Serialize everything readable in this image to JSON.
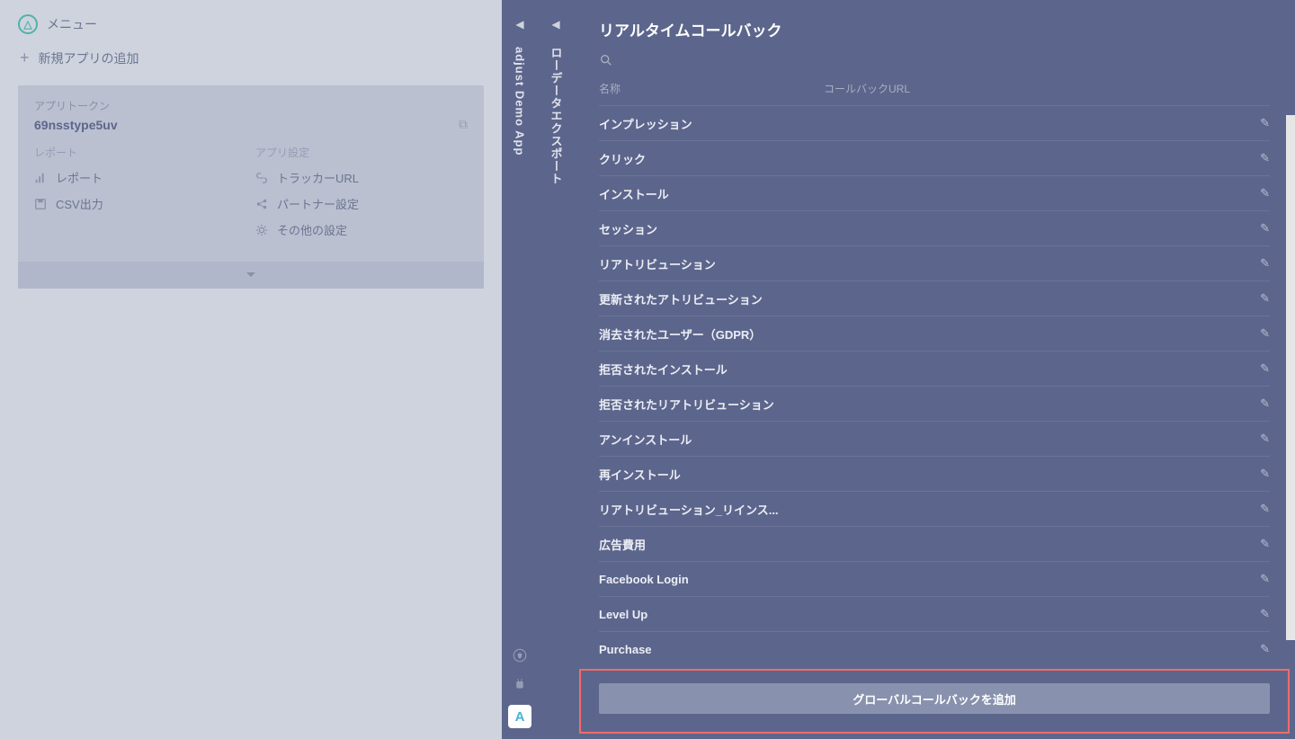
{
  "menu_label": "メニュー",
  "add_app_label": "新規アプリの追加",
  "app_card": {
    "token_label": "アプリトークン",
    "token_value": "69nsstype5uv",
    "report_header": "レポート",
    "settings_header": "アプリ設定",
    "report_items": [
      {
        "label": "レポート",
        "icon": "bars"
      },
      {
        "label": "CSV出力",
        "icon": "save"
      }
    ],
    "settings_items": [
      {
        "label": "トラッカーURL",
        "icon": "link"
      },
      {
        "label": "パートナー設定",
        "icon": "share"
      },
      {
        "label": "その他の設定",
        "icon": "gear"
      }
    ]
  },
  "rail1_label": "adjust Demo App",
  "rail2_label": "ローデータエクスポート",
  "panel_title": "リアルタイムコールバック",
  "th_name": "名称",
  "th_url": "コールバックURL",
  "callbacks": [
    "インプレッション",
    "クリック",
    "インストール",
    "セッション",
    "リアトリビューション",
    "更新されたアトリビューション",
    "消去されたユーザー（GDPR）",
    "拒否されたインストール",
    "拒否されたリアトリビューション",
    "アンインストール",
    "再インストール",
    "リアトリビューション_リインス...",
    "広告費用",
    "Facebook Login",
    "Level Up",
    "Purchase"
  ],
  "add_global_label": "グローバルコールバックを追加"
}
